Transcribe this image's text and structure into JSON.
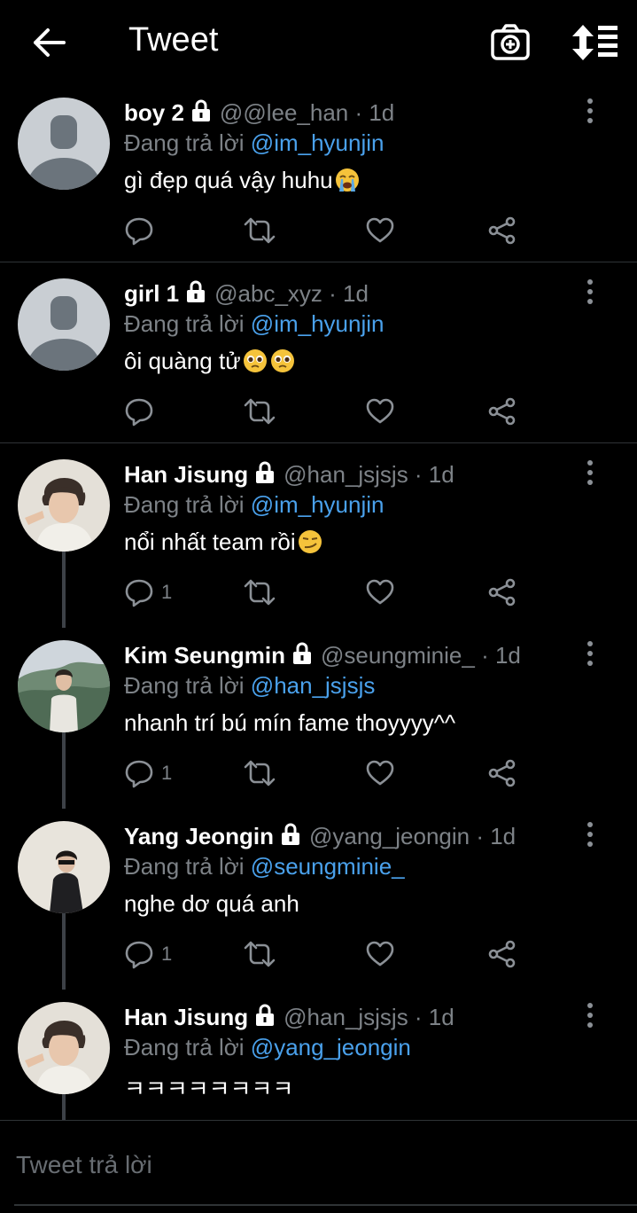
{
  "header": {
    "title": "Tweet"
  },
  "tweets": [
    {
      "name": "boy 2",
      "handle": "@@lee_han · 1d",
      "reply_prefix": "Đang trả lời",
      "reply_to": "@im_hyunjin",
      "text": "gì đẹp quá vậy huhu",
      "emoji": [
        "loudly-crying-face"
      ],
      "reply_count": ""
    },
    {
      "name": "girl 1",
      "handle": "@abc_xyz · 1d",
      "reply_prefix": "Đang trả lời",
      "reply_to": "@im_hyunjin",
      "text": "ôi quàng tử",
      "emoji": [
        "pleading-face",
        "pleading-face"
      ],
      "reply_count": ""
    },
    {
      "name": "Han Jisung",
      "handle": "@han_jsjsjs · 1d",
      "reply_prefix": "Đang trả lời",
      "reply_to": "@im_hyunjin",
      "text": "nổi nhất team rồi",
      "emoji": [
        "smirking-face"
      ],
      "reply_count": "1"
    },
    {
      "name": "Kim Seungmin",
      "handle": "@seungminie_ · 1d",
      "reply_prefix": "Đang trả lời",
      "reply_to": "@han_jsjsjs",
      "text": "nhanh trí bú mín fame thoyyyy^^",
      "emoji": [],
      "reply_count": "1"
    },
    {
      "name": "Yang Jeongin",
      "handle": "@yang_jeongin · 1d",
      "reply_prefix": "Đang trả lời",
      "reply_to": "@seungminie_",
      "text": "nghe dơ quá anh",
      "emoji": [],
      "reply_count": "1"
    },
    {
      "name": "Han Jisung",
      "handle": "@han_jsjsjs · 1d",
      "reply_prefix": "Đang trả lời",
      "reply_to": "@yang_jeongin",
      "text": "ㅋㅋㅋㅋㅋㅋㅋㅋ",
      "emoji": [],
      "reply_count": ""
    }
  ],
  "reply_box": {
    "placeholder": "Tweet trả lời"
  },
  "colors": {
    "background": "#000000",
    "accent": "#4aa1ec",
    "muted": "#7d8287",
    "divider": "#2f3336"
  }
}
